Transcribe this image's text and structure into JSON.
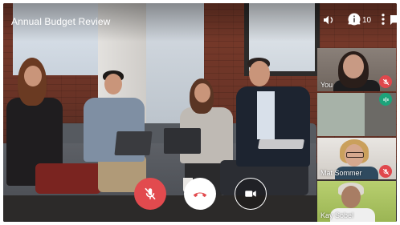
{
  "meeting": {
    "title": "Annual Budget Review",
    "participant_count": "10"
  },
  "participants": [
    {
      "name": "You",
      "status": "muted"
    },
    {
      "name": "",
      "status": "speaking"
    },
    {
      "name": "Mat Sommer",
      "status": "muted"
    },
    {
      "name": "Kay Sobel",
      "status": ""
    }
  ],
  "controls": {
    "mute": "mic-off-icon",
    "hangup": "phone-hangup-icon",
    "camera": "videocam-icon"
  },
  "top_icons": [
    "volume-icon",
    "people-icon",
    "chat-icon",
    "info-icon",
    "more-vert-icon"
  ],
  "colors": {
    "mute_red": "#e24a4e",
    "speaking_green": "#1ca37a",
    "hangup_red": "#e24a4e",
    "text": "#ffffff"
  }
}
